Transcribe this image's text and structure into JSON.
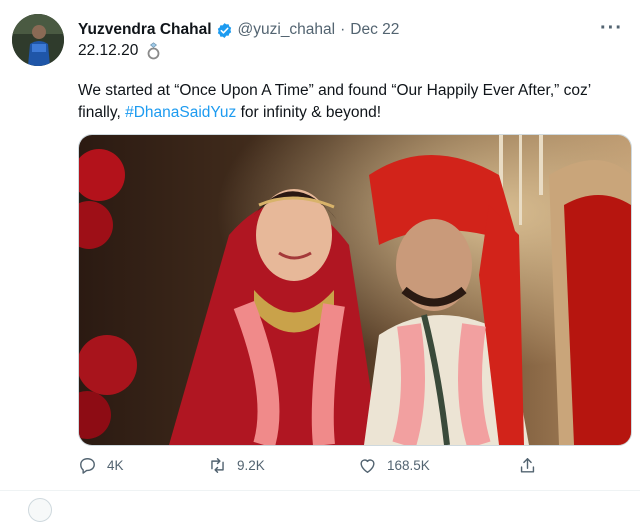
{
  "author": {
    "name": "Yuzvendra Chahal",
    "handle": "@yuzi_chahal",
    "separator": "·",
    "date": "Dec 22",
    "verified_icon": "verified-badge-icon"
  },
  "subline": {
    "text": "22.12.20",
    "icon": "ring-icon"
  },
  "tweet": {
    "text_part1": "We started at “Once Upon A Time” and found “Our Happily Ever After,” coz’ finally, ",
    "hashtag": "#DhanaSaidYuz",
    "text_part2": " for infinity & beyond!"
  },
  "more_label": "···",
  "actions": {
    "reply_count": "4K",
    "retweet_count": "9.2K",
    "like_count": "168.5K"
  },
  "colors": {
    "link": "#1d9bf0",
    "muted": "#536471",
    "text": "#0f1419"
  }
}
